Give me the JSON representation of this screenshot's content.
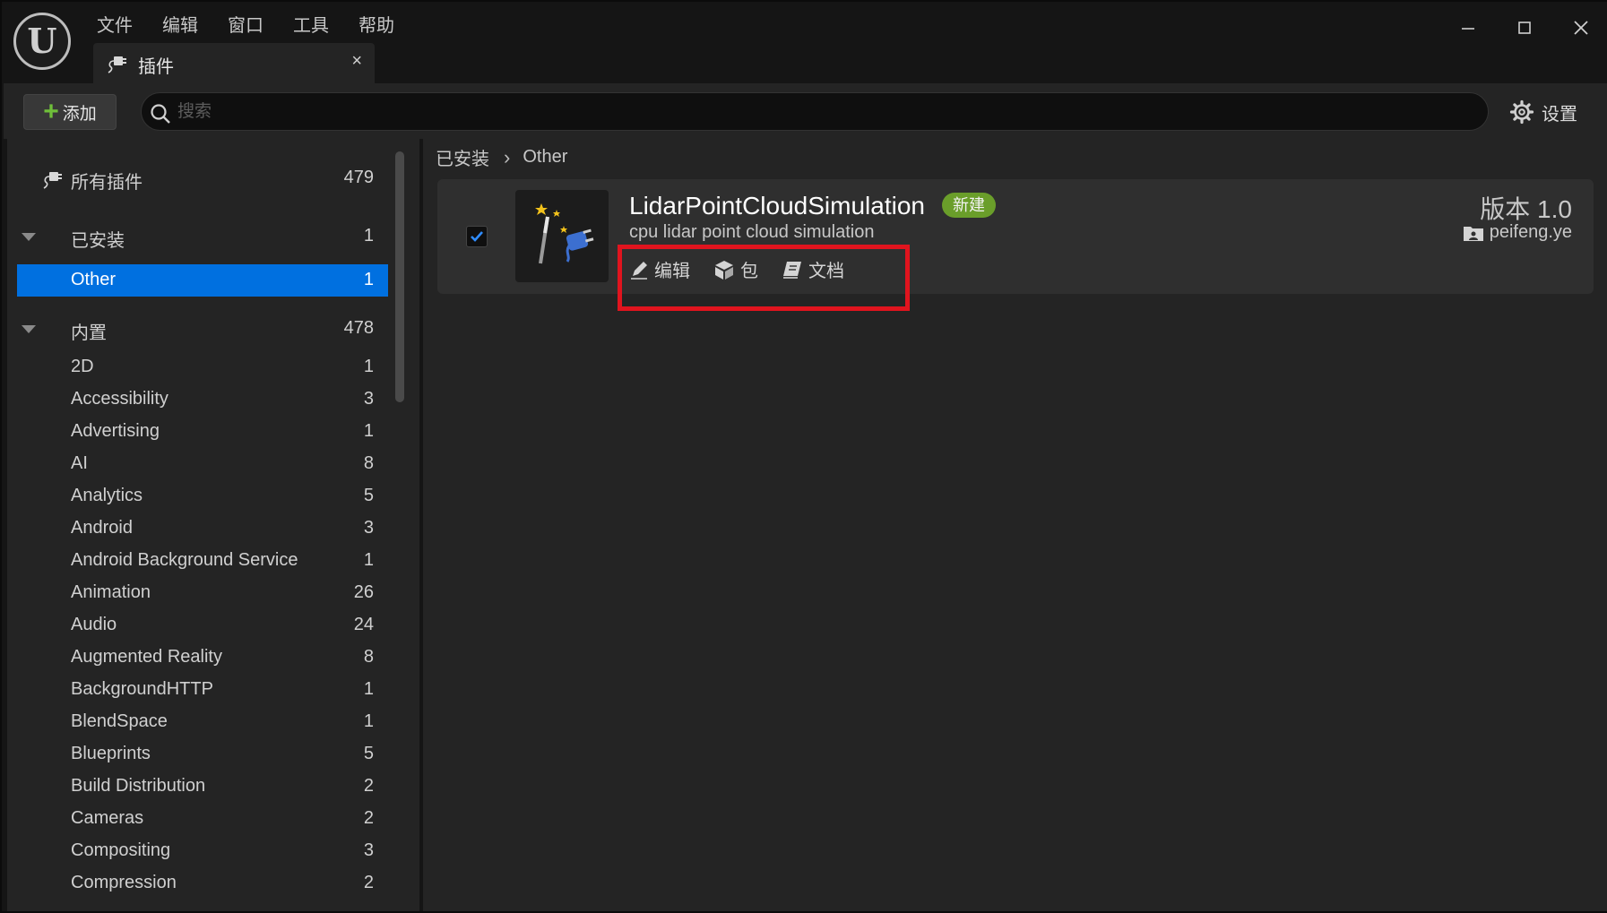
{
  "menu": [
    "文件",
    "编辑",
    "窗口",
    "工具",
    "帮助"
  ],
  "tab": {
    "label": "插件",
    "close": "×"
  },
  "toolbar": {
    "add_label": "添加",
    "search_placeholder": "搜索",
    "settings_label": "设置"
  },
  "sidebar": {
    "all": {
      "label": "所有插件",
      "count": "479"
    },
    "installed": {
      "label": "已安装",
      "count": "1"
    },
    "other": {
      "label": "Other",
      "count": "1"
    },
    "builtin": {
      "label": "内置",
      "count": "478"
    },
    "categories": [
      {
        "label": "2D",
        "count": "1"
      },
      {
        "label": "Accessibility",
        "count": "3"
      },
      {
        "label": "Advertising",
        "count": "1"
      },
      {
        "label": "AI",
        "count": "8"
      },
      {
        "label": "Analytics",
        "count": "5"
      },
      {
        "label": "Android",
        "count": "3"
      },
      {
        "label": "Android Background Service",
        "count": "1"
      },
      {
        "label": "Animation",
        "count": "26"
      },
      {
        "label": "Audio",
        "count": "24"
      },
      {
        "label": "Augmented Reality",
        "count": "8"
      },
      {
        "label": "BackgroundHTTP",
        "count": "1"
      },
      {
        "label": "BlendSpace",
        "count": "1"
      },
      {
        "label": "Blueprints",
        "count": "5"
      },
      {
        "label": "Build Distribution",
        "count": "2"
      },
      {
        "label": "Cameras",
        "count": "2"
      },
      {
        "label": "Compositing",
        "count": "3"
      },
      {
        "label": "Compression",
        "count": "2"
      }
    ]
  },
  "breadcrumb": {
    "root": "已安装",
    "current": "Other"
  },
  "plugin": {
    "name": "LidarPointCloudSimulation",
    "badge": "新建",
    "description": "cpu lidar point cloud simulation",
    "enabled": true,
    "actions": {
      "edit": "编辑",
      "package": "包",
      "docs": "文档"
    },
    "version": "版本 1.0",
    "author": "peifeng.ye"
  },
  "colors": {
    "selection": "#0070e0",
    "badge": "#6a9e2a",
    "highlight": "#e0141e",
    "add_plus": "#6fbf3a"
  }
}
